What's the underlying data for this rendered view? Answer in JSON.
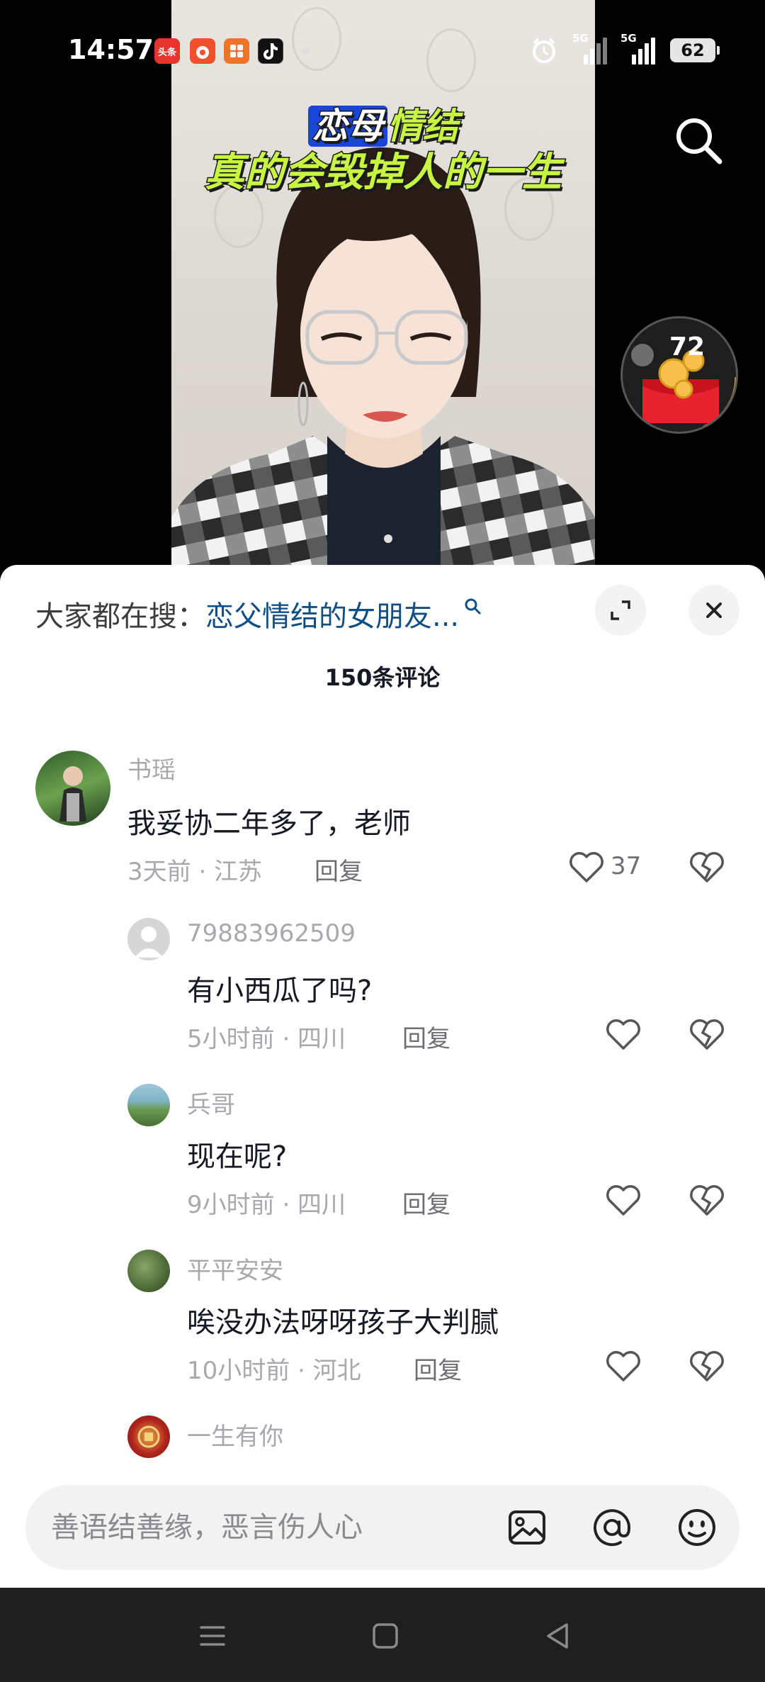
{
  "status_bar": {
    "time": "14:57",
    "notification_icons": [
      "toutiao-icon",
      "red-app-icon",
      "orange-app-icon",
      "tiktok-icon"
    ],
    "notification_badge_text": "头条",
    "network_1": "5G",
    "network_2": "5G",
    "battery": "62"
  },
  "video": {
    "caption_word_1": "恋母",
    "caption_word_2": "情结",
    "caption_line_2": "真的会毁掉人的一生",
    "coin_count": "72"
  },
  "comments_panel": {
    "hot_search_label": "大家都在搜：",
    "hot_search_query": "恋父情结的女朋友...",
    "count_label": "150条评论",
    "comments": [
      {
        "user": "书瑶",
        "text": "我妥协二年多了，老师",
        "meta": "3天前 · 江苏",
        "reply": "回复",
        "likes": "37"
      },
      {
        "user": "79883962509",
        "text": "有小西瓜了吗?",
        "meta": "5小时前 · 四川",
        "reply": "回复"
      },
      {
        "user": "兵哥",
        "text": "现在呢?",
        "meta": "9小时前 · 四川",
        "reply": "回复"
      },
      {
        "user": "平平安安",
        "text": "唉没办法呀呀孩子大判腻",
        "meta": "10小时前 · 河北",
        "reply": "回复"
      },
      {
        "user": "一生有你"
      }
    ]
  },
  "input_bar": {
    "placeholder": "善语结善缘，恶言伤人心"
  },
  "colors": {
    "accent_link": "#0f4f86",
    "caption_green": "#c8f542",
    "caption_blue": "#1946d8"
  }
}
